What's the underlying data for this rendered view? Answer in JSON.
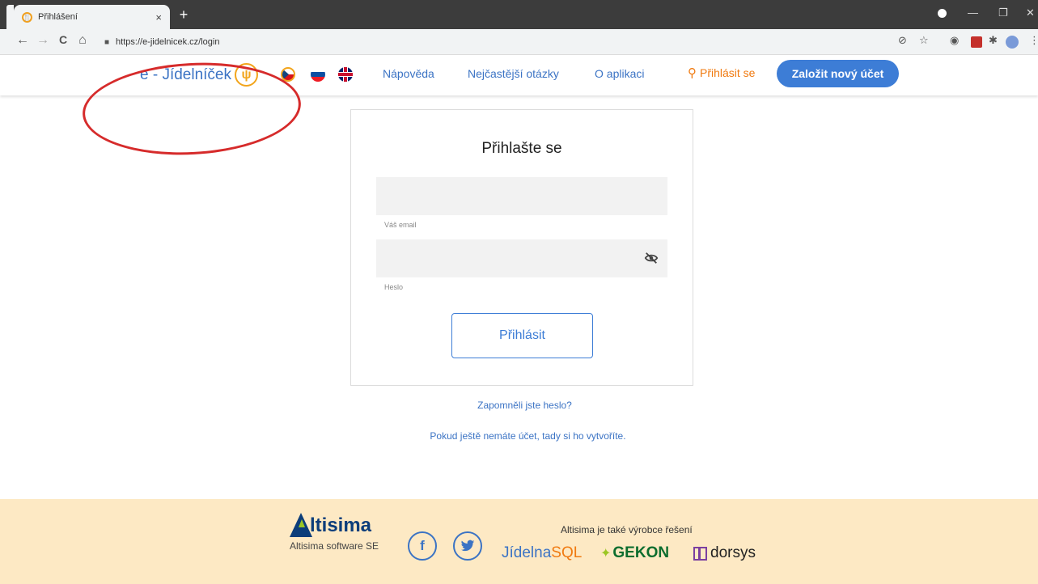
{
  "browser": {
    "tab_title": "Přihlášení",
    "tab_close": "×",
    "new_tab": "+",
    "url": "https://e-jidelnicek.cz/login",
    "back": "←",
    "forward": "→",
    "reload": "C",
    "home": "⌂",
    "lock": "🔒",
    "icons": [
      "back-icon",
      "forward-icon",
      "reload-icon",
      "home-icon",
      "lock-icon",
      "eye-slash-icon",
      "star-icon",
      "extension-icon",
      "pdf-icon",
      "puzzle-icon",
      "music-icon",
      "menu-icon"
    ]
  },
  "header": {
    "logo_text": "e - Jídelníček",
    "logo_icon": "🍴",
    "nav": [
      "Nápověda",
      "Nejčastější otázky",
      "O aplikaci"
    ],
    "login_label": "Přihlásit se",
    "signup_label": "Založit nový účet"
  },
  "login": {
    "title": "Přihlašte se",
    "email_label": "Váš email",
    "password_label": "Heslo",
    "submit_label": "Přihlásit",
    "forgot_label": "Zapomněli jste heslo?",
    "signup_hint": "Pokud ještě nemáte účet, tady si ho vytvoříte."
  },
  "footer": {
    "altisima_name": "ltisima",
    "altisima_sub": "Altisima software SE",
    "also_text": "Altisima je také výrobce řešení",
    "facebook": "f",
    "twitter": "🐦",
    "jidelna_a": "Jídelna",
    "jidelna_b": "SQL",
    "gekon": "GEKON",
    "dorsys": "dorsys"
  },
  "colors": {
    "brand_blue": "#3b73c4",
    "accent_orange": "#f07a10",
    "footer_bg": "#fde9c4",
    "annotation_red": "#d62b2b"
  }
}
